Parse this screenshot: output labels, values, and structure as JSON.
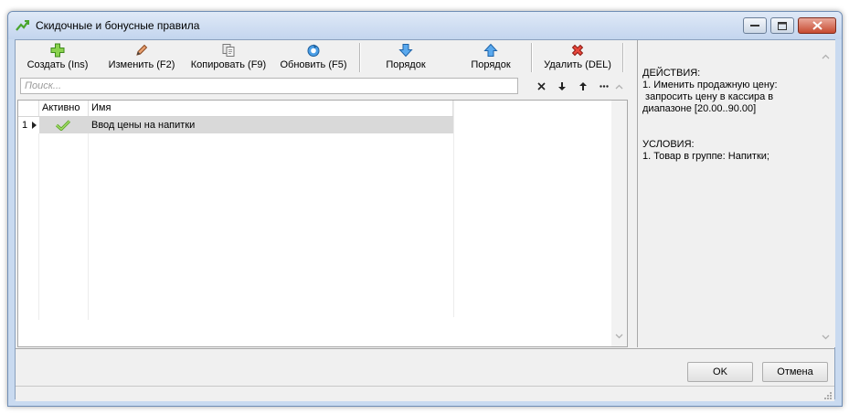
{
  "window": {
    "title": "Скидочные и бонусные правила"
  },
  "toolbar": {
    "create_label": "Создать (Ins)",
    "edit_label": "Изменить (F2)",
    "copy_label": "Копировать (F9)",
    "refresh_label": "Обновить (F5)",
    "order_down_label": "Порядок",
    "order_up_label": "Порядок",
    "delete_label": "Удалить (DEL)"
  },
  "search": {
    "placeholder": "Поиск..."
  },
  "grid": {
    "columns": [
      "Активно",
      "Имя"
    ],
    "rows": [
      {
        "number": "1",
        "active": true,
        "name": "Ввод цены на напитки"
      }
    ]
  },
  "details": {
    "actions_header": "ДЕЙСТВИЯ:",
    "action_1_line_1": "1. Именить продажную цену:",
    "action_1_line_2": " запросить цену в кассира в",
    "action_1_line_3": "диапазоне [20.00..90.00]",
    "conditions_header": "УСЛОВИЯ:",
    "condition_1": "1. Товар в группе: Напитки;"
  },
  "buttons": {
    "ok_label": "OK",
    "cancel_label": "Отмена"
  },
  "colors": {
    "selected_row": "#d9d9d9",
    "check_green": "#7ac142",
    "create_green": "#5cb82c",
    "arrow_blue": "#3a8fd9",
    "delete_red": "#d9342b"
  }
}
